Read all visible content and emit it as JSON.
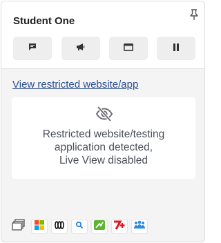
{
  "student": {
    "name": "Student One"
  },
  "header_icons": {
    "pin": "pin-icon"
  },
  "actions": [
    {
      "name": "message",
      "icon": "message-icon"
    },
    {
      "name": "announce",
      "icon": "megaphone-icon"
    },
    {
      "name": "window",
      "icon": "window-icon"
    },
    {
      "name": "pause",
      "icon": "pause-icon"
    }
  ],
  "restricted": {
    "link_label": "View restricted website/app",
    "icon": "eye-slash-icon",
    "message_lines": [
      "Restricted website/testing",
      "application detected,",
      "Live View disabled"
    ]
  },
  "apps": [
    {
      "icon": "stacked-windows-icon"
    },
    {
      "icon": "microsoft-icon"
    },
    {
      "icon": "abc-icon"
    },
    {
      "icon": "search-icon"
    },
    {
      "icon": "green-arrow-icon"
    },
    {
      "icon": "seven-plus-icon"
    },
    {
      "icon": "people-icon"
    }
  ],
  "colors": {
    "link": "#2d4f8e",
    "text": "#4a4f58",
    "button_bg": "#eeeeee",
    "card_bg": "#f4f4f4"
  }
}
